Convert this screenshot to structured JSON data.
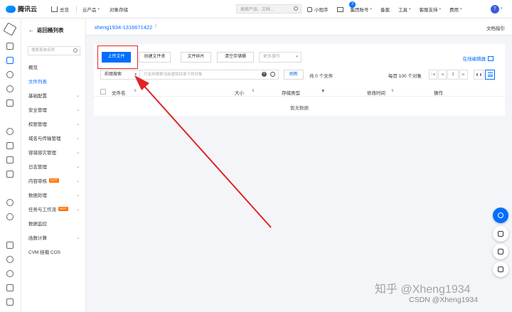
{
  "topbar": {
    "brand": "腾讯云",
    "home": "总览",
    "products": "云产品",
    "current_product": "对象存储",
    "search_placeholder": "搜索产品、文档...",
    "mini_program": "小程序",
    "mail_badge": "3",
    "group_account": "集团账号",
    "record": "备案",
    "tools": "工具",
    "support": "客服支持",
    "cost": "费用",
    "avatar_letter": "T"
  },
  "nav": {
    "back": "返回桶列表",
    "search_placeholder": "搜索菜单名称",
    "items": [
      {
        "label": "概览"
      },
      {
        "label": "文件列表"
      },
      {
        "label": "基础配置"
      },
      {
        "label": "安全管理"
      },
      {
        "label": "权限管理"
      },
      {
        "label": "域名与传输管理"
      },
      {
        "label": "容错容灾管理"
      },
      {
        "label": "日志管理"
      },
      {
        "label": "内容审核",
        "badge": "HOT"
      },
      {
        "label": "数据处理"
      },
      {
        "label": "任务与工作流",
        "badge": "HOT"
      },
      {
        "label": "数据监控"
      },
      {
        "label": "函数计算"
      },
      {
        "label": "CVM 挂载 COS"
      }
    ]
  },
  "breadcrumb": {
    "bucket": "xheng1934-1316671422",
    "separator": "/",
    "doc_guide": "文档指引"
  },
  "toolbar": {
    "upload": "上传文件",
    "create_folder": "创建文件夹",
    "file_fragments": "文件碎片",
    "clear_bucket": "清空存储桶",
    "more_actions": "更多操作",
    "online_editor": "在线编辑器"
  },
  "filter": {
    "prefix_search": "前缀搜索",
    "search_placeholder": "只支持搜索当前虚拟目录下的对象",
    "refresh": "刷新",
    "count": "共 0 个文件",
    "per_page": "每页 100 个对象",
    "page_first": "|◀",
    "page_prev": "◀",
    "page_number": "1",
    "page_next": "▶"
  },
  "table": {
    "columns": [
      "文件名",
      "大小",
      "存储类型",
      "修改时间",
      "操作"
    ],
    "empty": "暂无数据"
  },
  "watermark": {
    "line1": "知乎 @Xheng1934",
    "line2": "CSDN @Xheng1934"
  },
  "colors": {
    "primary": "#006eff",
    "highlight": "#e02424",
    "hot_badge": "#ff7200"
  }
}
